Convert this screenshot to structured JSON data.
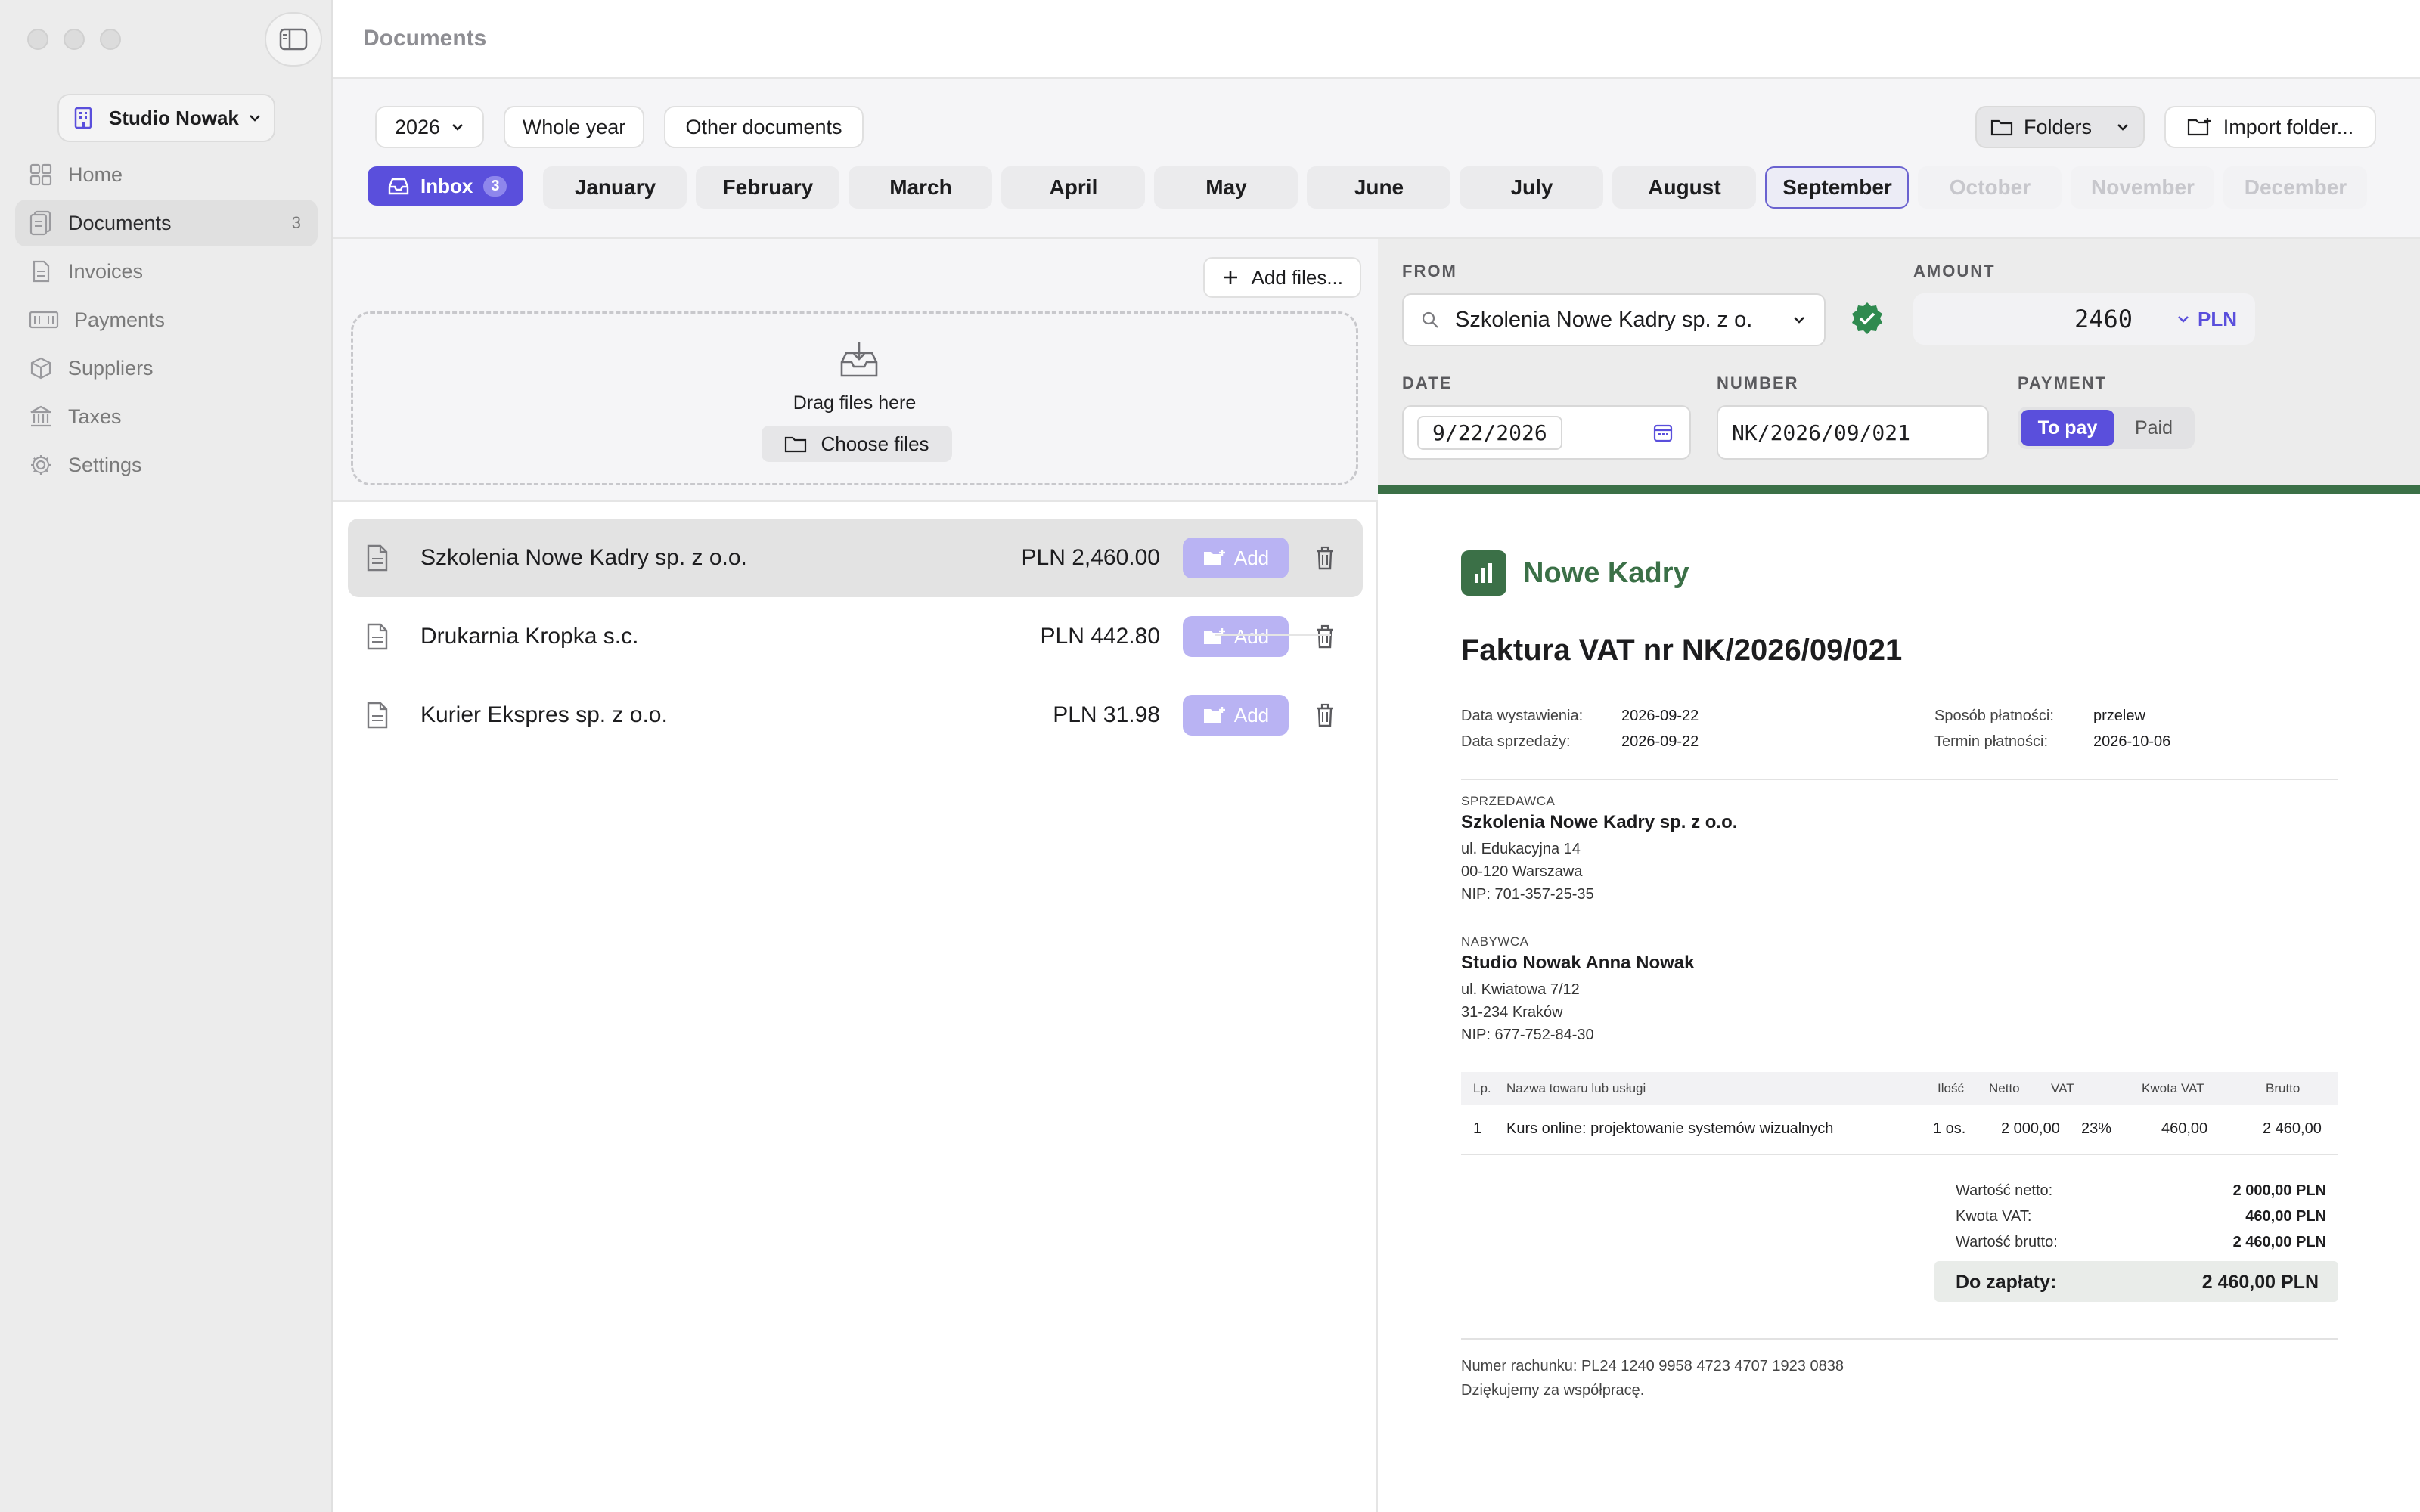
{
  "window": {
    "title": "Documents"
  },
  "sidebar": {
    "workspace": "Studio Nowak",
    "items": [
      {
        "label": "Home",
        "icon": "home-grid-icon"
      },
      {
        "label": "Documents",
        "icon": "documents-icon",
        "count": "3"
      },
      {
        "label": "Invoices",
        "icon": "invoice-icon"
      },
      {
        "label": "Payments",
        "icon": "payments-icon"
      },
      {
        "label": "Suppliers",
        "icon": "suppliers-box-icon"
      },
      {
        "label": "Taxes",
        "icon": "taxes-bank-icon"
      },
      {
        "label": "Settings",
        "icon": "gear-icon"
      }
    ]
  },
  "filters": {
    "year": "2026",
    "whole_year": "Whole year",
    "other_documents": "Other documents",
    "folders": "Folders",
    "import_folder": "Import folder...",
    "inbox_label": "Inbox",
    "inbox_count": "3",
    "months": [
      "January",
      "February",
      "March",
      "April",
      "May",
      "June",
      "July",
      "August",
      "September",
      "October",
      "November",
      "December"
    ],
    "selected_month": "September",
    "disabled_months": [
      "October",
      "November",
      "December"
    ]
  },
  "upload": {
    "add_files": "Add files...",
    "drag_text": "Drag files here",
    "choose_files": "Choose files"
  },
  "documents": [
    {
      "name": "Szkolenia Nowe Kadry sp. z o.o.",
      "amount": "PLN 2,460.00",
      "add_label": "Add",
      "selected": true
    },
    {
      "name": "Drukarnia Kropka s.c.",
      "amount": "PLN 442.80",
      "add_label": "Add",
      "selected": false
    },
    {
      "name": "Kurier Ekspres sp. z o.o.",
      "amount": "PLN 31.98",
      "add_label": "Add",
      "selected": false
    }
  ],
  "form": {
    "from_label": "FROM",
    "from_value": "Szkolenia Nowe Kadry sp. z o.",
    "amount_label": "AMOUNT",
    "amount_value": "2460",
    "currency": "PLN",
    "date_label": "DATE",
    "date_value": "9/22/2026",
    "number_label": "NUMBER",
    "number_value": "NK/2026/09/021",
    "payment_label": "PAYMENT",
    "payment_options": [
      "To pay",
      "Paid"
    ],
    "payment_selected": "To pay"
  },
  "invoice": {
    "brand": "Nowe Kadry",
    "title": "Faktura VAT nr NK/2026/09/021",
    "issue_date_label": "Data wystawienia:",
    "issue_date": "2026-09-22",
    "sale_date_label": "Data sprzedaży:",
    "sale_date": "2026-09-22",
    "payment_method_label": "Sposób płatności:",
    "payment_method": "przelew",
    "due_date_label": "Termin płatności:",
    "due_date": "2026-10-06",
    "seller": {
      "label": "SPRZEDAWCA",
      "name": "Szkolenia Nowe Kadry sp. z o.o.",
      "street": "ul. Edukacyjna 14",
      "city": "00-120 Warszawa",
      "nip": "NIP: 701-357-25-35"
    },
    "buyer": {
      "label": "NABYWCA",
      "name": "Studio Nowak Anna Nowak",
      "street": "ul. Kwiatowa 7/12",
      "city": "31-234 Kraków",
      "nip": "NIP: 677-752-84-30"
    },
    "table_headers": {
      "lp": "Lp.",
      "name": "Nazwa towaru lub usługi",
      "qty": "Ilość",
      "net": "Netto",
      "vat": "VAT",
      "vat_amount": "Kwota VAT",
      "gross": "Brutto"
    },
    "items": [
      {
        "lp": "1",
        "name": "Kurs online: projektowanie systemów wizualnych",
        "qty": "1 os.",
        "net": "2 000,00",
        "vat": "23%",
        "vat_amount": "460,00",
        "gross": "2 460,00"
      }
    ],
    "totals": {
      "net_label": "Wartość netto:",
      "net": "2 000,00 PLN",
      "vat_label": "Kwota VAT:",
      "vat": "460,00 PLN",
      "gross_label": "Wartość brutto:",
      "gross": "2 460,00 PLN",
      "due_label": "Do zapłaty:",
      "due": "2 460,00 PLN"
    },
    "account": "Numer rachunku: PL24 1240 9958 4723 4707 1923 0838",
    "thanks": "Dziękujemy za współpracę."
  },
  "colors": {
    "accent": "#5a4fdc",
    "brand_green": "#3b7047",
    "verified": "#2f8a4f"
  }
}
